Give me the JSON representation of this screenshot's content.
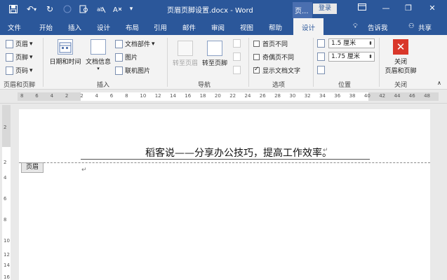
{
  "titlebar": {
    "title": "页眉页脚设置.docx  -  Word",
    "context_tab": "页...",
    "login": "登录",
    "icons": [
      "save-icon",
      "undo-icon",
      "redo-icon",
      "circle-icon",
      "print-preview-icon",
      "format-painter-icon",
      "dropdown-icon"
    ]
  },
  "tabs": [
    "文件",
    "开始",
    "插入",
    "设计",
    "布局",
    "引用",
    "邮件",
    "审阅",
    "视图",
    "帮助",
    "设计",
    "告诉我",
    "共享"
  ],
  "ribbon": {
    "header_footer_group": {
      "items": [
        "页眉",
        "页脚",
        "页码"
      ],
      "label": "页眉和页脚"
    },
    "insert_group": {
      "date_time": "日期和时间",
      "doc_info": "文档信息",
      "doc_parts": "文档部件",
      "picture": "图片",
      "online_picture": "联机图片",
      "label": "插入"
    },
    "nav_group": {
      "goto_header": "转至页眉",
      "goto_footer": "转至页脚",
      "label": "导航"
    },
    "options_group": {
      "first_page": "首页不同",
      "odd_even": "奇偶页不同",
      "show_text": "显示文档文字",
      "label": "选项"
    },
    "position_group": {
      "header_pos": "1.5 厘米",
      "footer_pos": "1.75 厘米",
      "label": "位置"
    },
    "close_group": {
      "close_line1": "关闭",
      "close_line2": "页眉和页脚",
      "label": "关闭"
    }
  },
  "ruler": {
    "numbers": [
      "8",
      "6",
      "4",
      "2",
      "2",
      "4",
      "6",
      "8",
      "10",
      "12",
      "14",
      "16",
      "18",
      "20",
      "22",
      "24",
      "26",
      "28",
      "30",
      "32",
      "34",
      "36",
      "38",
      "40",
      "42",
      "44",
      "46",
      "48"
    ],
    "corner": "L"
  },
  "vruler": {
    "numbers": [
      "2",
      "2",
      "4",
      "6",
      "8",
      "10",
      "12",
      "14",
      "16"
    ]
  },
  "document": {
    "header_text": "稻客说——分享办公技巧，提高工作效率。",
    "header_tag": "页眉",
    "para_mark": "↵"
  }
}
